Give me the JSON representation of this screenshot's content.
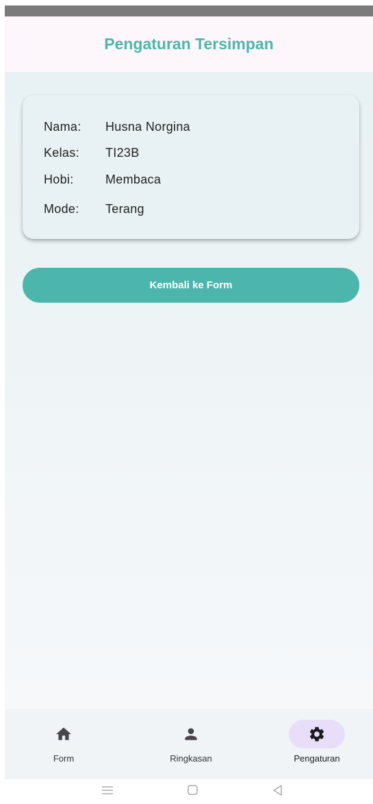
{
  "app_bar": {
    "title": "Pengaturan Tersimpan"
  },
  "card": {
    "rows": [
      {
        "label": "Nama:",
        "value": "Husna Norgina"
      },
      {
        "label": "Kelas:",
        "value": "TI23B"
      },
      {
        "label": "Hobi:",
        "value": "Membaca"
      },
      {
        "label": "Mode:",
        "value": "Terang"
      }
    ]
  },
  "back_button": {
    "label": "Kembali ke Form"
  },
  "bottom_nav": {
    "items": [
      {
        "label": "Form",
        "icon": "home-icon",
        "active": false
      },
      {
        "label": "Ringkasan",
        "icon": "person-icon",
        "active": false
      },
      {
        "label": "Pengaturan",
        "icon": "gear-icon",
        "active": true
      }
    ]
  },
  "colors": {
    "accent": "#4db6ac",
    "active_indicator": "#e9defa"
  }
}
